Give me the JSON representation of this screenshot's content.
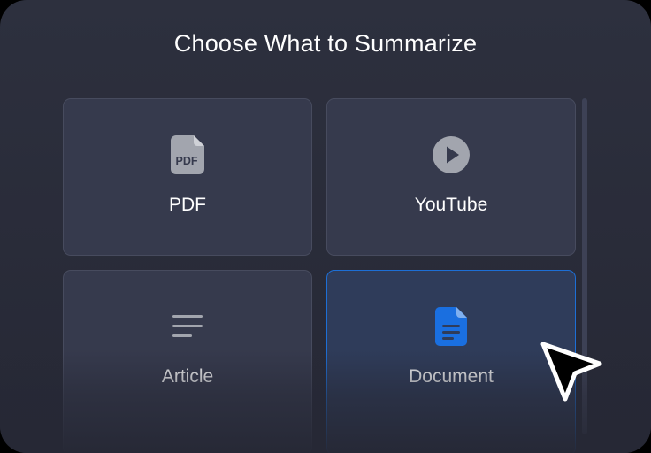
{
  "dialog": {
    "title": "Choose What to Summarize"
  },
  "options": [
    {
      "label": "PDF",
      "icon": "pdf-file-icon"
    },
    {
      "label": "YouTube",
      "icon": "play-circle-icon"
    },
    {
      "label": "Article",
      "icon": "text-lines-icon"
    },
    {
      "label": "Document",
      "icon": "document-icon",
      "selected": true
    }
  ],
  "icon_text": {
    "pdf": "PDF"
  },
  "colors": {
    "panel_background": "#2d303e",
    "card_background": "#363a4d",
    "selected_border": "#1d6fd6",
    "selected_icon": "#1a6fe0",
    "icon_gray": "#a2a5ae"
  },
  "cursor": {
    "icon": "mouse-pointer-icon"
  }
}
